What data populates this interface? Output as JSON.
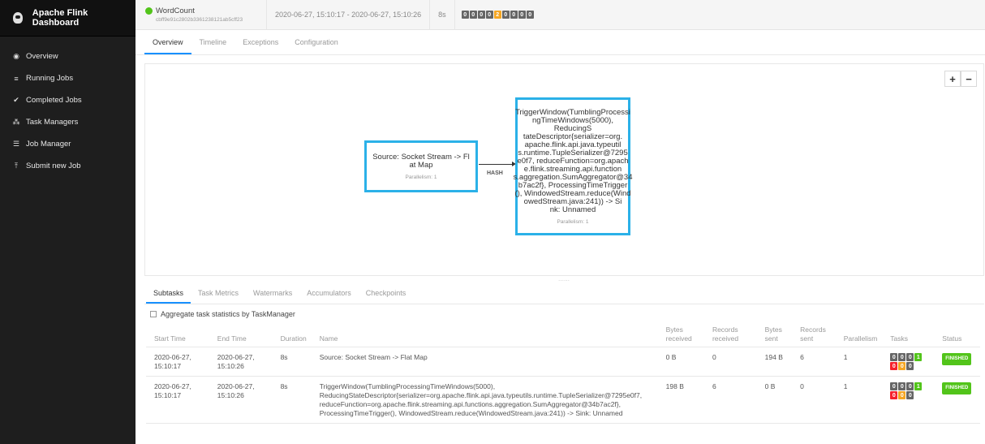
{
  "sidebar": {
    "brand": "Apache Flink Dashboard",
    "items": [
      {
        "icon": "dashboard-icon",
        "glyph": "◉",
        "label": "Overview"
      },
      {
        "icon": "list-icon",
        "glyph": "≡",
        "label": "Running Jobs"
      },
      {
        "icon": "check-circle-icon",
        "glyph": "✔",
        "label": "Completed Jobs"
      },
      {
        "icon": "cluster-icon",
        "glyph": "⁂",
        "label": "Task Managers"
      },
      {
        "icon": "server-icon",
        "glyph": "☰",
        "label": "Job Manager"
      },
      {
        "icon": "upload-icon",
        "glyph": "⤒",
        "label": "Submit new Job"
      }
    ]
  },
  "header": {
    "job_name": "WordCount",
    "job_id": "cbff9e91c2802b3361238121ab5cff23",
    "time_range": "2020-06-27, 15:10:17 - 2020-06-27, 15:10:26",
    "duration": "8s",
    "status_counts": [
      {
        "value": "0",
        "color": "#666666"
      },
      {
        "value": "0",
        "color": "#666666"
      },
      {
        "value": "0",
        "color": "#666666"
      },
      {
        "value": "0",
        "color": "#666666"
      },
      {
        "value": "2",
        "color": "#f5a623"
      },
      {
        "value": "0",
        "color": "#666666"
      },
      {
        "value": "0",
        "color": "#666666"
      },
      {
        "value": "0",
        "color": "#666666"
      },
      {
        "value": "0",
        "color": "#666666"
      }
    ]
  },
  "tabs": [
    "Overview",
    "Timeline",
    "Exceptions",
    "Configuration"
  ],
  "graph": {
    "zoom_in": "+",
    "zoom_out": "−",
    "node1": {
      "title": "Source: Socket Stream -> Fl\nat Map",
      "parallelism": "Parallelism: 1"
    },
    "node2": {
      "title": "TriggerWindow(TumblingProcessi\nngTimeWindows(5000), ReducingS\ntateDescriptor{serializer=org.\napache.flink.api.java.typeutil\ns.runtime.TupleSerializer@7295\ne0f7, reduceFunction=org.apach\ne.flink.streaming.api.function\ns.aggregation.SumAggregator@34\nb7ac2f}, ProcessingTimeTrigger\n(), WindowedStream.reduce(Wind\nowedStream.java:241)) -> Si\nnk: Unnamed",
      "parallelism": "Parallelism: 1"
    },
    "edge_label": "HASH"
  },
  "subtabs": [
    "Subtasks",
    "Task Metrics",
    "Watermarks",
    "Accumulators",
    "Checkpoints"
  ],
  "aggregate_label": "Aggregate task statistics by TaskManager",
  "table": {
    "headers": [
      "Start Time",
      "End Time",
      "Duration",
      "Name",
      "Bytes received",
      "Records received",
      "Bytes sent",
      "Records sent",
      "Parallelism",
      "Tasks",
      "Status"
    ],
    "rows": [
      {
        "start": "2020-06-27, 15:10:17",
        "end": "2020-06-27, 15:10:26",
        "duration": "8s",
        "name": "Source: Socket Stream -> Flat Map",
        "bytes_received": "0 B",
        "records_received": "0",
        "bytes_sent": "194 B",
        "records_sent": "6",
        "parallelism": "1",
        "tasks": [
          {
            "value": "0",
            "color": "#666666"
          },
          {
            "value": "0",
            "color": "#666666"
          },
          {
            "value": "0",
            "color": "#666666"
          },
          {
            "value": "1",
            "color": "#52c41a"
          },
          {
            "value": "0",
            "color": "#f5222d"
          },
          {
            "value": "0",
            "color": "#f5a623"
          },
          {
            "value": "0",
            "color": "#666666"
          }
        ],
        "status": "FINISHED"
      },
      {
        "start": "2020-06-27, 15:10:17",
        "end": "2020-06-27, 15:10:26",
        "duration": "8s",
        "name": "TriggerWindow(TumblingProcessingTimeWindows(5000), ReducingStateDescriptor{serializer=org.apache.flink.api.java.typeutils.runtime.TupleSerializer@7295e0f7, reduceFunction=org.apache.flink.streaming.api.functions.aggregation.SumAggregator@34b7ac2f}, ProcessingTimeTrigger(), WindowedStream.reduce(WindowedStream.java:241)) -> Sink: Unnamed",
        "bytes_received": "198 B",
        "records_received": "6",
        "bytes_sent": "0 B",
        "records_sent": "0",
        "parallelism": "1",
        "tasks": [
          {
            "value": "0",
            "color": "#666666"
          },
          {
            "value": "0",
            "color": "#666666"
          },
          {
            "value": "0",
            "color": "#666666"
          },
          {
            "value": "1",
            "color": "#52c41a"
          },
          {
            "value": "0",
            "color": "#f5222d"
          },
          {
            "value": "0",
            "color": "#f5a623"
          },
          {
            "value": "0",
            "color": "#666666"
          }
        ],
        "status": "FINISHED"
      }
    ]
  }
}
